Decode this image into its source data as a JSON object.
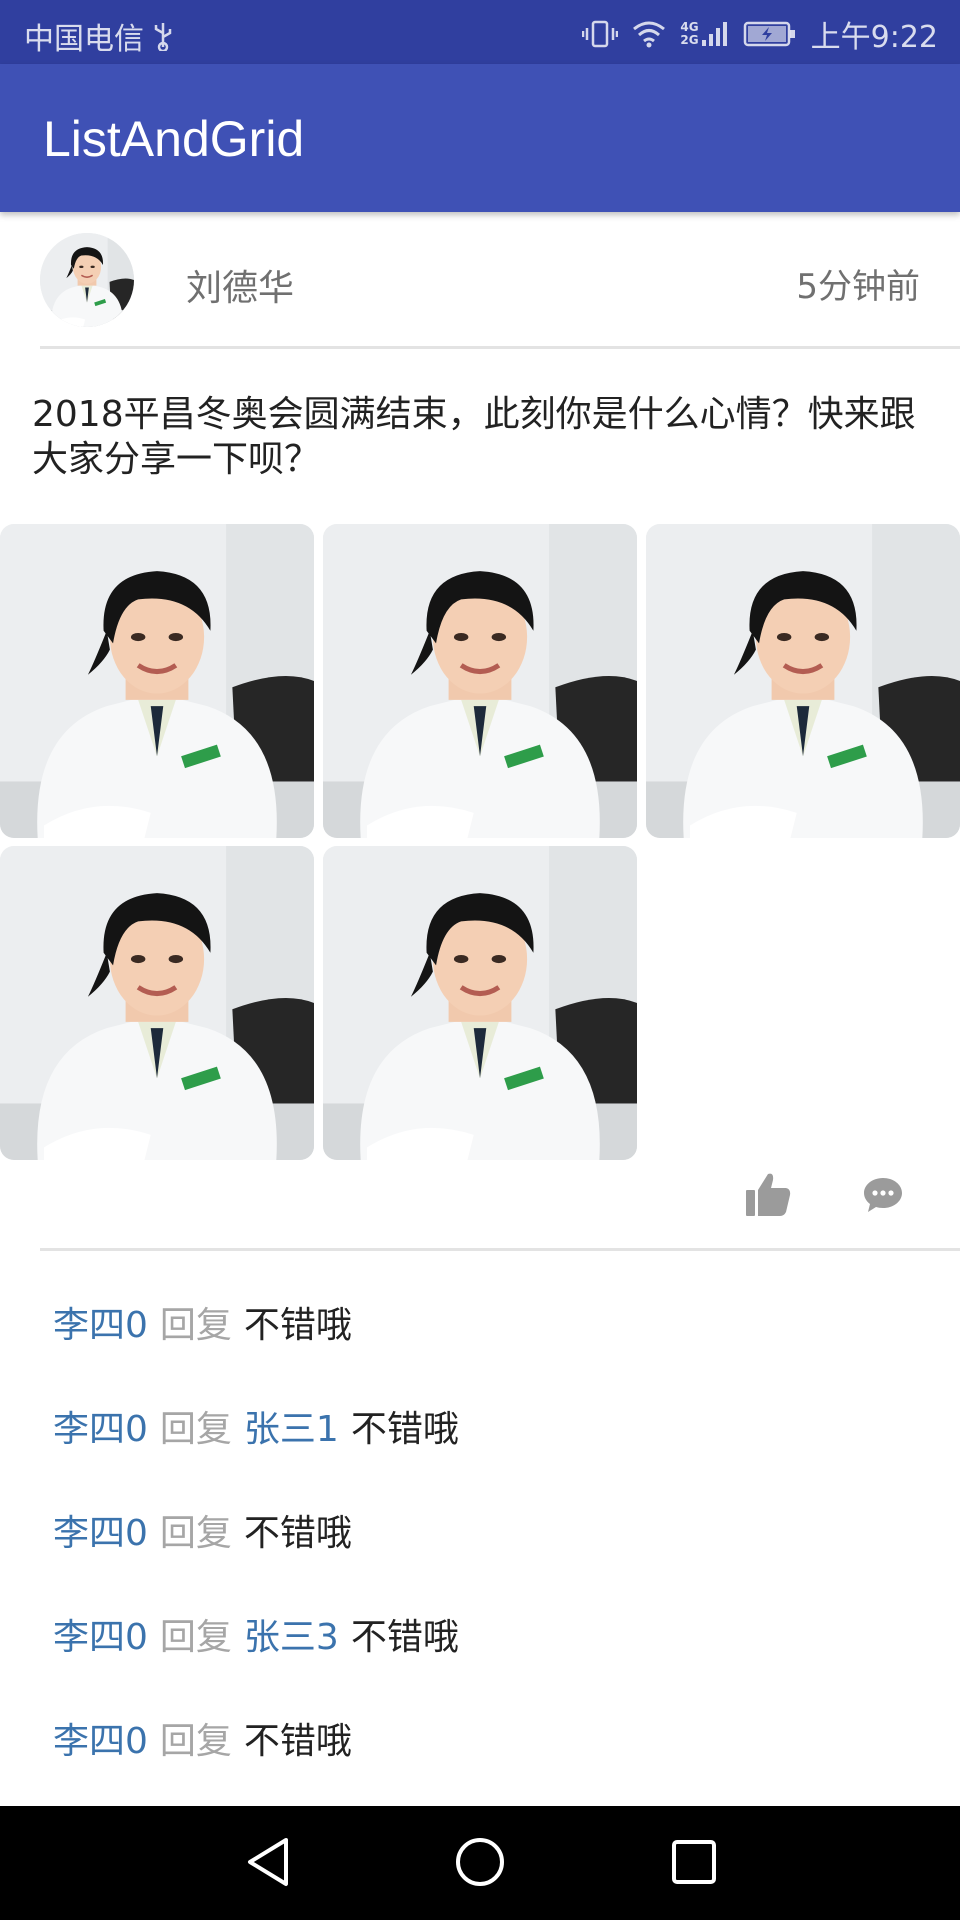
{
  "status_bar": {
    "carrier": "中国电信",
    "network_labels": [
      "4G",
      "2G"
    ],
    "time": "上午9:22"
  },
  "app": {
    "title": "ListAndGrid"
  },
  "post": {
    "user_name": "刘德华",
    "time": "5分钟前",
    "text": "2018平昌冬奥会圆满结束，此刻你是什么心情？快来跟大家分享一下呗？",
    "photo_count": 5
  },
  "actions": {
    "like_icon": "thumbs-up-icon",
    "comment_icon": "comment-bubble-icon"
  },
  "comments": [
    {
      "name": "李四0",
      "reply_label": "回复",
      "target": "",
      "text": "不错哦"
    },
    {
      "name": "李四0",
      "reply_label": "回复",
      "target": "张三1",
      "text": "不错哦"
    },
    {
      "name": "李四0",
      "reply_label": "回复",
      "target": "",
      "text": "不错哦"
    },
    {
      "name": "李四0",
      "reply_label": "回复",
      "target": "张三3",
      "text": "不错哦"
    },
    {
      "name": "李四0",
      "reply_label": "回复",
      "target": "",
      "text": "不错哦"
    }
  ],
  "colors": {
    "status_bar": "#303f9f",
    "app_bar": "#3f51b5",
    "comment_name": "#3b73ad",
    "reply_label": "#a6a6a6"
  }
}
